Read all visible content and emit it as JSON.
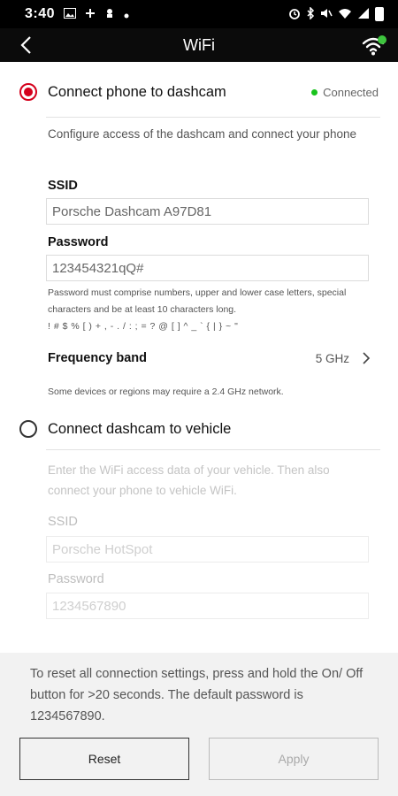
{
  "status_bar": {
    "time": "3:40"
  },
  "app_bar": {
    "title": "WiFi"
  },
  "phone_section": {
    "title": "Connect phone to dashcam",
    "status": "Connected",
    "description": "Configure access of the dashcam and connect your phone",
    "ssid_label": "SSID",
    "ssid_value": "Porsche Dashcam A97D81",
    "password_label": "Password",
    "password_value": "123454321qQ#",
    "password_hint_1": "Password must comprise numbers, upper and lower case letters, special characters and be at least 10 characters long.",
    "password_hint_2": "! # $ % [ ) + , - . / : ; = ? @ [ ] ^ _ ` { | } ~ \"",
    "frequency_label": "Frequency band",
    "frequency_value": "5 GHz",
    "frequency_hint": "Some devices or regions may require a 2.4 GHz network."
  },
  "vehicle_section": {
    "title": "Connect dashcam to vehicle",
    "description": "Enter the WiFi access data of your vehicle. Then also connect your phone to vehicle WiFi.",
    "ssid_label": "SSID",
    "ssid_value": "Porsche HotSpot",
    "password_label": "Password",
    "password_value": "1234567890"
  },
  "footer": {
    "text": "To reset all connection settings, press and hold the On/ Off button for >20 seconds. The default password is 1234567890.",
    "reset_label": "Reset",
    "apply_label": "Apply"
  },
  "colors": {
    "accent": "#d5001c",
    "connected": "#19c31c",
    "wifi_icon": "#3ec53e"
  }
}
